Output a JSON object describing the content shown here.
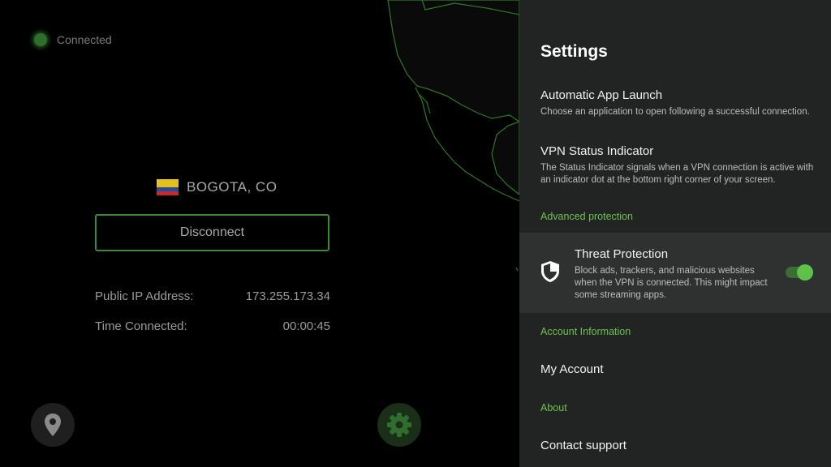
{
  "status": {
    "text": "Connected",
    "icon": "status-dot-icon",
    "color": "#2f6e2c"
  },
  "location": {
    "name": "BOGOTA, CO",
    "flag_icon": "colombia-flag-icon"
  },
  "disconnect": {
    "label": "Disconnect",
    "border_color": "#3b8a36"
  },
  "info": {
    "ip_label": "Public IP Address:",
    "ip_value": "173.255.173.34",
    "time_label": "Time Connected:",
    "time_value": "00:00:45"
  },
  "bottom_buttons": {
    "location_icon": "location-pin-icon",
    "settings_icon": "gear-icon"
  },
  "settings": {
    "title": "Settings",
    "auto_launch": {
      "title": "Automatic App Launch",
      "desc": "Choose an application to open following a successful connection."
    },
    "status_indicator": {
      "title": "VPN Status Indicator",
      "desc": "The Status Indicator signals when a VPN connection is active with an indicator dot at the bottom right corner of your screen."
    },
    "sections": {
      "advanced": "Advanced protection",
      "account": "Account Information",
      "about": "About"
    },
    "threat": {
      "title": "Threat Protection",
      "desc": "Block ads, trackers, and malicious websites when the VPN is connected. This might impact some streaming apps.",
      "icon": "shield-icon",
      "enabled": true
    },
    "my_account": "My Account",
    "contact_support": "Contact support"
  },
  "colors": {
    "accent": "#6fc24f",
    "panel": "#222323",
    "map_line": "#2d7a25"
  }
}
